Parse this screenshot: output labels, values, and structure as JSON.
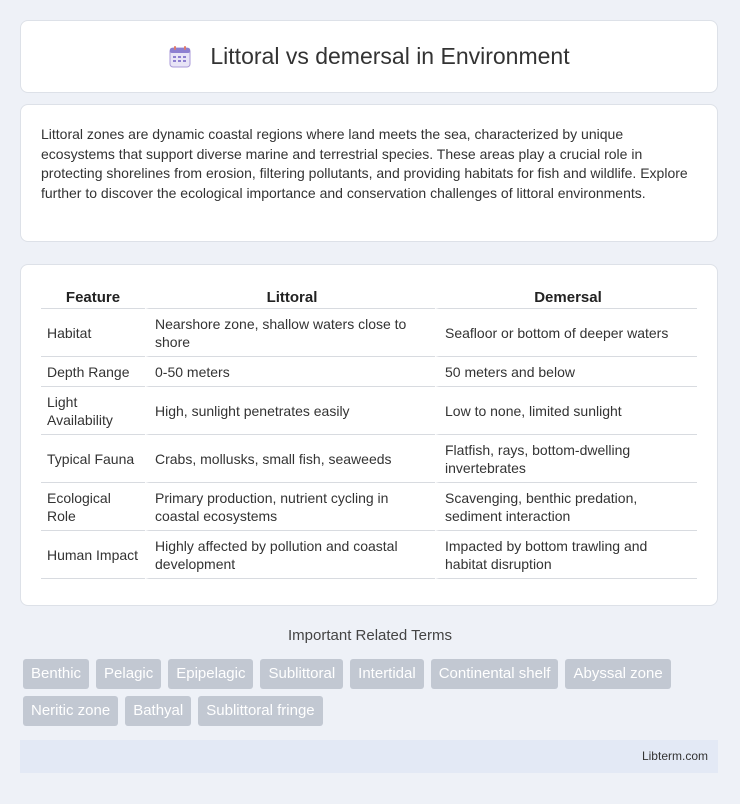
{
  "header": {
    "title": "Littoral vs demersal in Environment",
    "icon": "calendar-icon"
  },
  "intro": "Littoral zones are dynamic coastal regions where land meets the sea, characterized by unique ecosystems that support diverse marine and terrestrial species. These areas play a crucial role in protecting shorelines from erosion, filtering pollutants, and providing habitats for fish and wildlife. Explore further to discover the ecological importance and conservation challenges of littoral environments.",
  "table": {
    "headers": [
      "Feature",
      "Littoral",
      "Demersal"
    ],
    "rows": [
      {
        "feature": "Habitat",
        "littoral": "Nearshore zone, shallow waters close to shore",
        "demersal": "Seafloor or bottom of deeper waters"
      },
      {
        "feature": "Depth Range",
        "littoral": "0-50 meters",
        "demersal": "50 meters and below"
      },
      {
        "feature": "Light Availability",
        "littoral": "High, sunlight penetrates easily",
        "demersal": "Low to none, limited sunlight"
      },
      {
        "feature": "Typical Fauna",
        "littoral": "Crabs, mollusks, small fish, seaweeds",
        "demersal": "Flatfish, rays, bottom-dwelling invertebrates"
      },
      {
        "feature": "Ecological Role",
        "littoral": "Primary production, nutrient cycling in coastal ecosystems",
        "demersal": "Scavenging, benthic predation, sediment interaction"
      },
      {
        "feature": "Human Impact",
        "littoral": "Highly affected by pollution and coastal development",
        "demersal": "Impacted by bottom trawling and habitat disruption"
      }
    ]
  },
  "related": {
    "title": "Important Related Terms",
    "tags": [
      "Benthic",
      "Pelagic",
      "Epipelagic",
      "Sublittoral",
      "Intertidal",
      "Continental shelf",
      "Abyssal zone",
      "Neritic zone",
      "Bathyal",
      "Sublittoral fringe"
    ]
  },
  "footer": {
    "brand": "Libterm.com"
  },
  "colors": {
    "background": "#eef1f7",
    "tag_bg": "#c2c8d2",
    "footer_bg": "#e3e9f5"
  }
}
